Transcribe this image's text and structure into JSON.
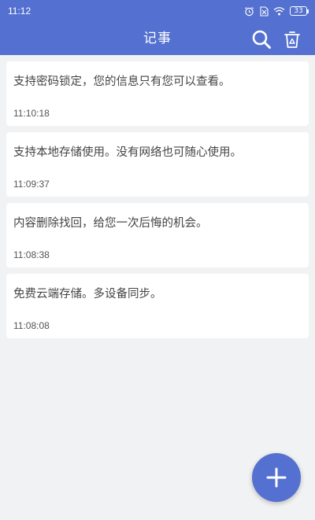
{
  "status_bar": {
    "time": "11:12",
    "battery": "33",
    "icons": [
      "alarm-icon",
      "no-sim-icon",
      "wifi-icon",
      "battery-icon"
    ]
  },
  "app_bar": {
    "title": "记事",
    "icons": [
      "search-icon",
      "recycle-bin-icon"
    ]
  },
  "notes": [
    {
      "text": "支持密码锁定，您的信息只有您可以查看。",
      "time": "11:10:18"
    },
    {
      "text": "支持本地存储使用。没有网络也可随心使用。",
      "time": "11:09:37"
    },
    {
      "text": "内容删除找回，给您一次后悔的机会。",
      "time": "11:08:38"
    },
    {
      "text": "免费云端存储。多设备同步。",
      "time": "11:08:08"
    }
  ],
  "fab": {
    "icon": "plus-icon"
  },
  "colors": {
    "primary": "#5470d0",
    "background": "#f1f2f3",
    "card": "#ffffff",
    "text": "#444444"
  }
}
